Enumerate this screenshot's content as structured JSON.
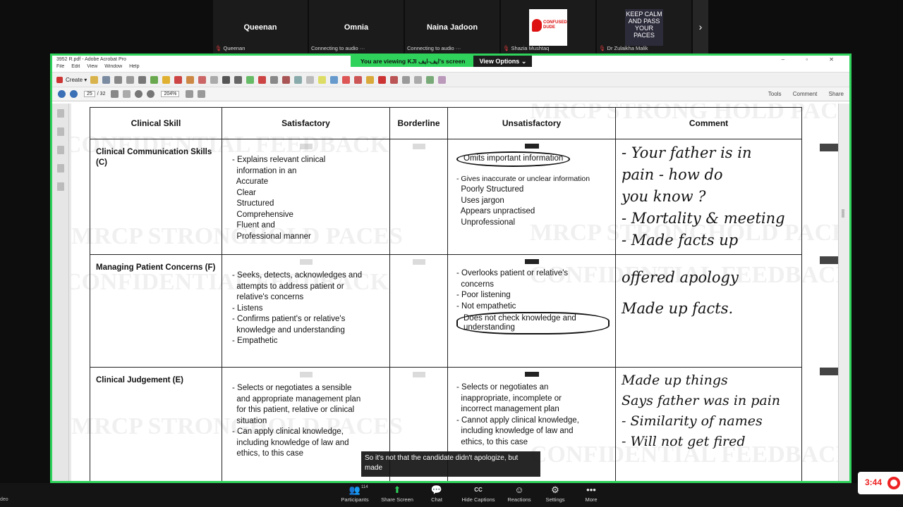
{
  "participants": [
    {
      "name": "Queenan",
      "sub": "Queenan",
      "muted": true
    },
    {
      "name": "Omnia",
      "sub": "Connecting to audio ···",
      "muted": false
    },
    {
      "name": "Naina Jadoon",
      "sub": "Connecting to audio ···",
      "muted": false
    },
    {
      "name": "",
      "sub": "Shazia Mushtaq",
      "muted": true,
      "thumb": "CONFUSED DUDE"
    },
    {
      "name": "",
      "sub": "Dr Zulaikha Malik",
      "muted": true,
      "thumb": "KEEP CALM AND PASS YOUR PACES"
    }
  ],
  "strip_next": "›",
  "share_banner": {
    "viewing": "You are viewing KJI ایف-ایف's screen",
    "view_options": "View Options ⌄"
  },
  "acrobat": {
    "title": "3952 R.pdf - Adobe Acrobat Pro",
    "window_controls": "– ▫ ✕",
    "menu": [
      "File",
      "Edit",
      "View",
      "Window",
      "Help"
    ],
    "create_label": "Create ▾",
    "page_current": "25",
    "page_total": "/ 32",
    "zoom": "204%",
    "right_links": [
      "Tools",
      "Comment",
      "Share"
    ]
  },
  "watermarks": [
    "MRCP STRONG HOLD PACES",
    "CONFIDENTIAL FEEDBACK",
    "MRCP STRONGHOLD PACES",
    "CONFIDENTIAL FEEDBACK"
  ],
  "form": {
    "headers": [
      "Clinical Skill",
      "Satisfactory",
      "Borderline",
      "Unsatisfactory",
      "Comment"
    ],
    "rows": [
      {
        "skill": "Clinical Communication Skills (C)",
        "satisfactory": [
          "- Explains relevant clinical",
          "  information in an",
          "  Accurate",
          "  Clear",
          "  Structured",
          "  Comprehensive",
          "  Fluent and",
          "  Professional manner"
        ],
        "unsatisfactory_circled": "Omits important information",
        "unsatisfactory": [
          "- Gives inaccurate or unclear information",
          "  Poorly Structured",
          "  Uses jargon",
          "  Appears unpractised",
          "  Unprofessional"
        ],
        "comment": [
          "- Your father is in",
          "   pain - how do",
          "  you know ?",
          "- Mortality & meeting",
          "- Made facts up"
        ]
      },
      {
        "skill": "Managing Patient Concerns (F)",
        "satisfactory": [
          "- Seeks, detects, acknowledges and",
          "  attempts to address patient or",
          "  relative's concerns",
          "- Listens",
          "- Confirms patient's or relative's",
          "  knowledge and understanding",
          "- Empathetic"
        ],
        "unsatisfactory": [
          "- Overlooks patient or relative's",
          "  concerns",
          "- Poor listening",
          "- Not empathetic"
        ],
        "unsatisfactory_circled": "Does not check knowledge and understanding",
        "comment": [
          "offered apology",
          "Made up facts."
        ]
      },
      {
        "skill": "Clinical Judgement (E)",
        "satisfactory": [
          "- Selects or negotiates a sensible",
          "  and appropriate management plan",
          "  for this patient, relative or clinical",
          "  situation",
          "- Can apply clinical knowledge,",
          "  including knowledge of law and",
          "  ethics, to this case"
        ],
        "unsatisfactory": [
          "- Selects or negotiates an",
          "  inappropriate, incomplete or",
          "  incorrect management plan",
          "- Cannot apply clinical knowledge,",
          "  including knowledge of law and",
          "  ethics, to this case"
        ],
        "comment": [
          "Made up things",
          "Says father was in pain",
          "- Similarity of names",
          "- Will not get fired"
        ]
      }
    ]
  },
  "caption": "So it's not that the candidate didn't apologize, but made",
  "controls": [
    {
      "label": "Participants",
      "icon": "👥",
      "sup": "114"
    },
    {
      "label": "Share Screen",
      "icon": "⬆",
      "active": true
    },
    {
      "label": "Chat",
      "icon": "💬"
    },
    {
      "label": "Hide Captions",
      "icon": "CC"
    },
    {
      "label": "Reactions",
      "icon": "☺"
    },
    {
      "label": "Settings",
      "icon": "⚙"
    },
    {
      "label": "More",
      "icon": "•••"
    }
  ],
  "timer": "3:44",
  "left_edge_label": "deo",
  "colors": {
    "share_border": "#2fd35c",
    "record": "#e22222"
  }
}
